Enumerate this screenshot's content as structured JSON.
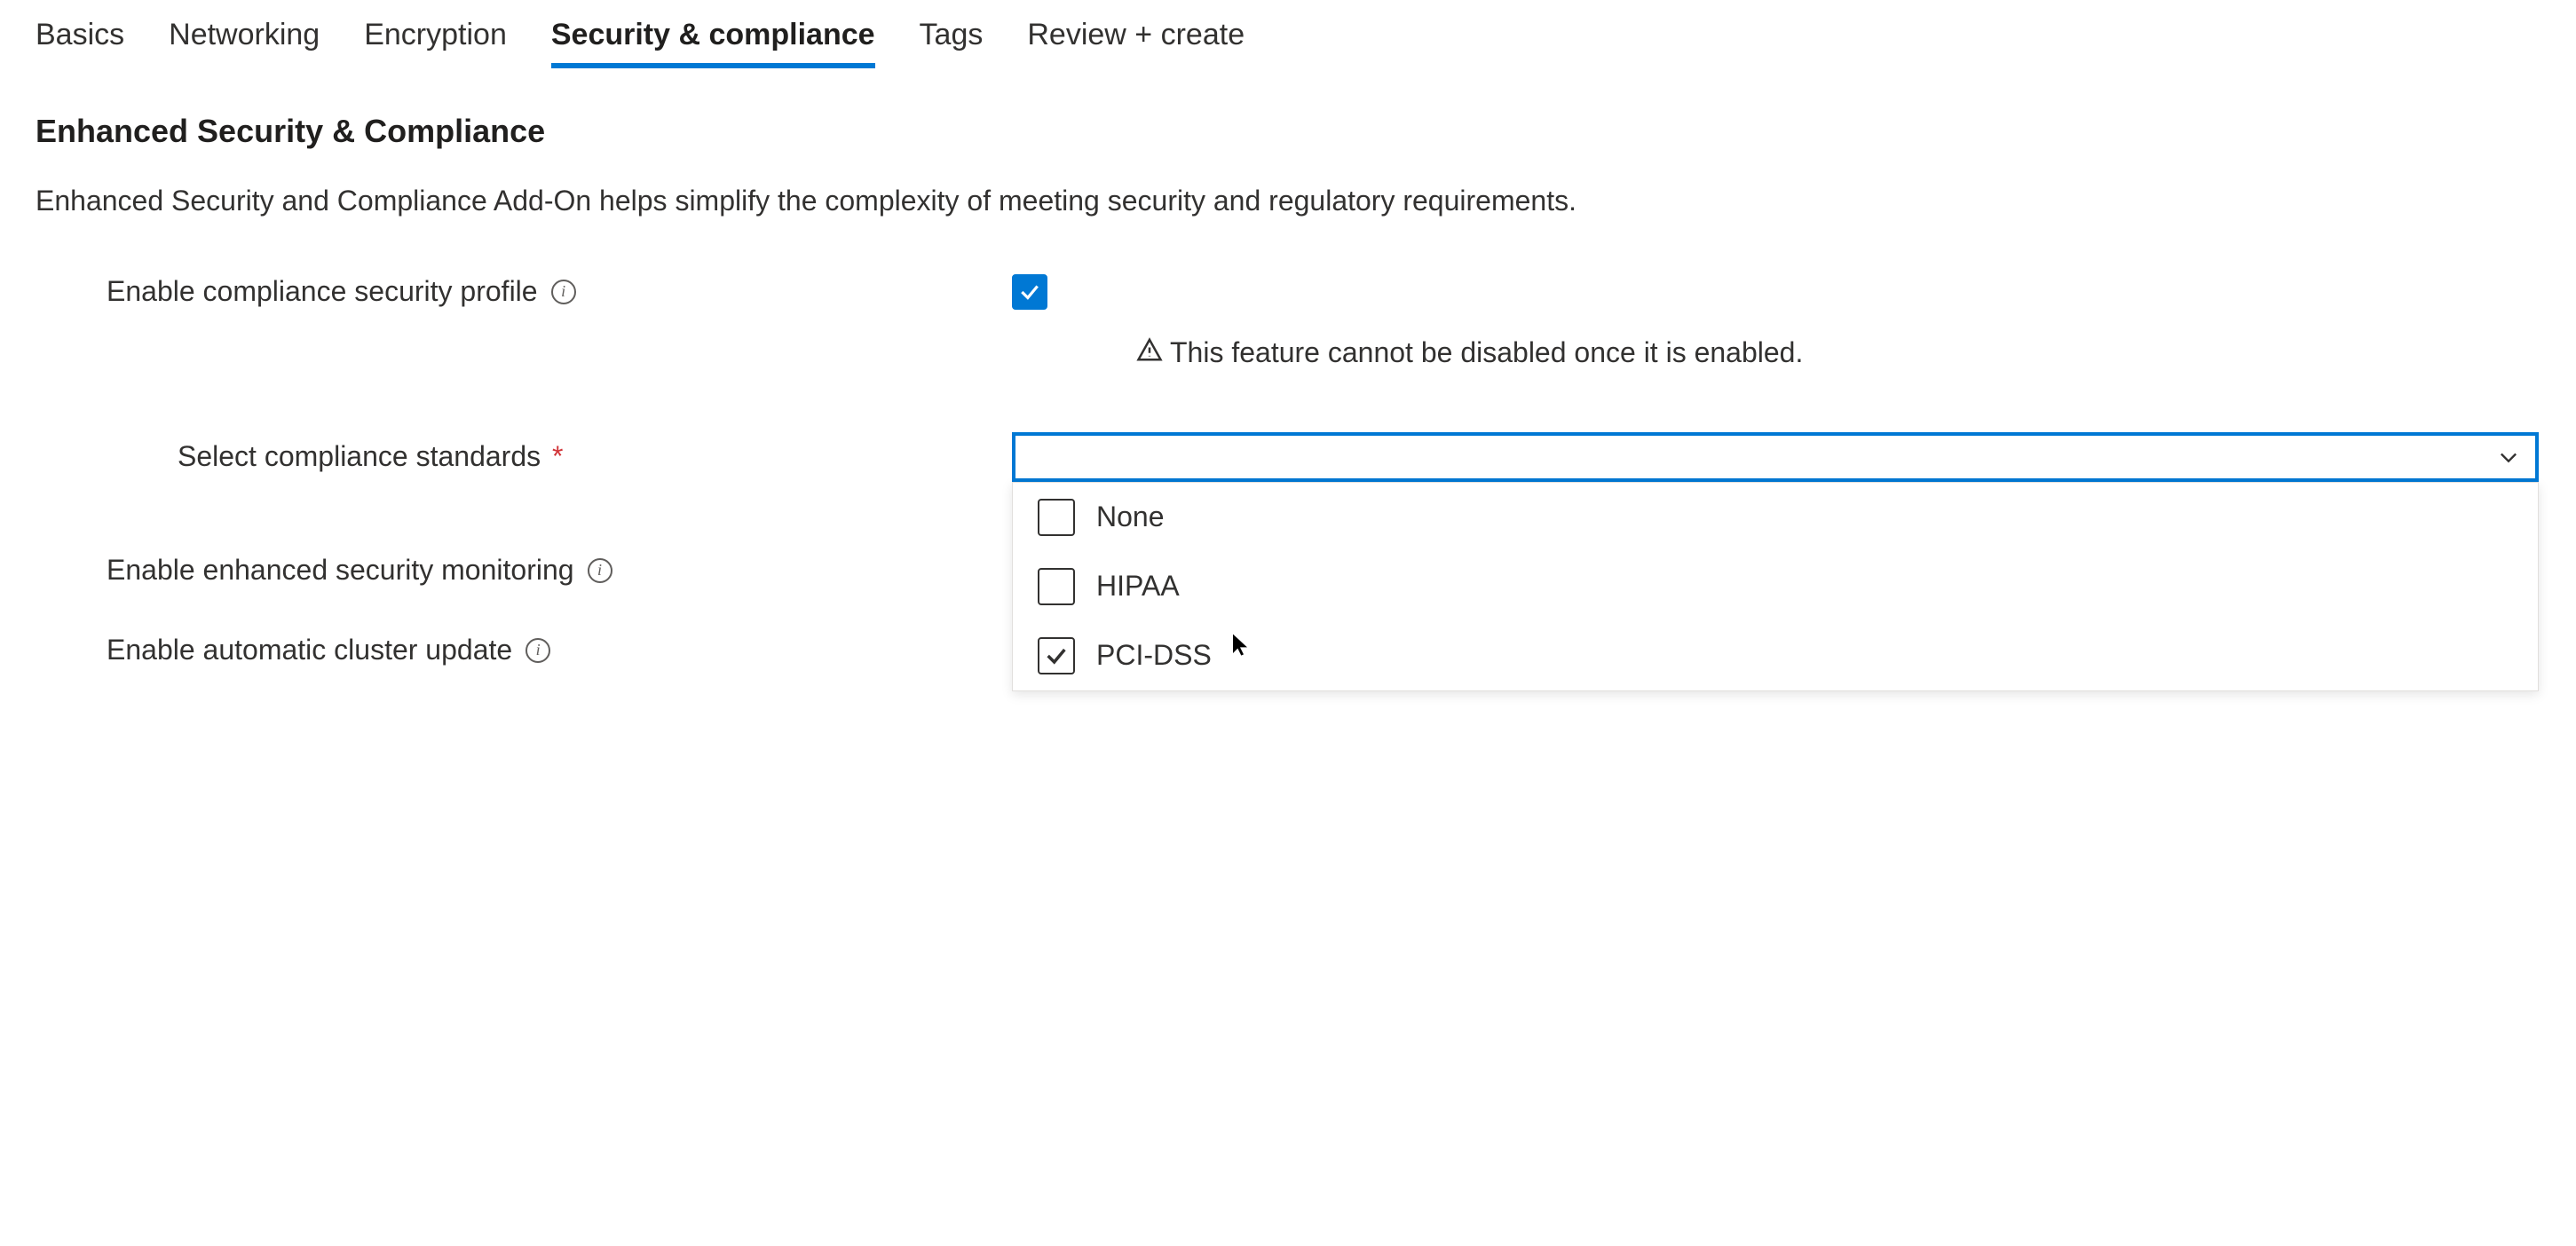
{
  "tabs": [
    {
      "label": "Basics",
      "active": false
    },
    {
      "label": "Networking",
      "active": false
    },
    {
      "label": "Encryption",
      "active": false
    },
    {
      "label": "Security & compliance",
      "active": true
    },
    {
      "label": "Tags",
      "active": false
    },
    {
      "label": "Review + create",
      "active": false
    }
  ],
  "section": {
    "title": "Enhanced Security & Compliance",
    "description": "Enhanced Security and Compliance Add-On helps simplify the complexity of meeting security and regulatory requirements."
  },
  "fields": {
    "enable_profile": {
      "label": "Enable compliance security profile",
      "checked": true,
      "warning": "This feature cannot be disabled once it is enabled."
    },
    "standards": {
      "label": "Select compliance standards",
      "required": true,
      "selected_value": "",
      "options": [
        {
          "label": "None",
          "checked": false
        },
        {
          "label": "HIPAA",
          "checked": false
        },
        {
          "label": "PCI-DSS",
          "checked": true
        }
      ]
    },
    "enable_monitoring": {
      "label": "Enable enhanced security monitoring",
      "checked": true
    },
    "enable_auto_update": {
      "label": "Enable automatic cluster update",
      "checked": true
    }
  },
  "colors": {
    "accent": "#0078d4",
    "required": "#d13438"
  }
}
